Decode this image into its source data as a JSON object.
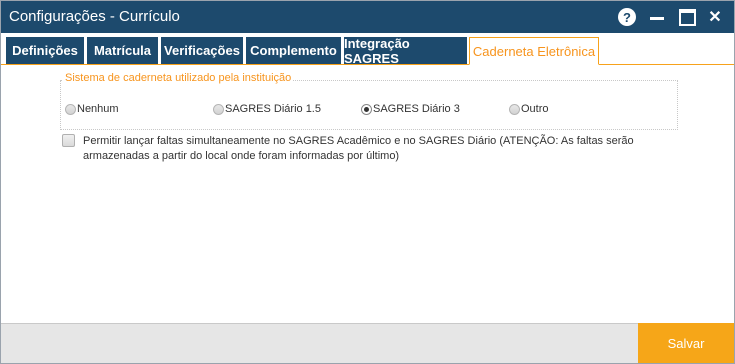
{
  "window": {
    "title": "Configurações - Currículo"
  },
  "titlebar": {
    "help_icon": "help-circle-icon",
    "help_glyph": "?",
    "close_glyph": "✕"
  },
  "tabs": [
    {
      "label": "Definições"
    },
    {
      "label": "Matrícula"
    },
    {
      "label": "Verificações"
    },
    {
      "label": "Complemento"
    },
    {
      "label": "Integração SAGRES"
    },
    {
      "label": "Caderneta Eletrônica",
      "active": true
    }
  ],
  "caderneta": {
    "group_label": "Sistema de caderneta utilizado pela instituição",
    "options": [
      {
        "label": "Nenhum",
        "checked": false
      },
      {
        "label": "SAGRES Diário 1.5",
        "checked": false
      },
      {
        "label": "SAGRES Diário 3",
        "checked": true
      },
      {
        "label": "Outro",
        "checked": false
      }
    ],
    "faltas_checkbox": {
      "checked": false,
      "label": "Permitir lançar faltas simultaneamente no SAGRES Acadêmico e no SAGRES Diário (ATENÇÃO: As faltas serão armazenadas a partir do local onde foram informadas por último)"
    }
  },
  "footer": {
    "save_label": "Salvar"
  },
  "colors": {
    "titlebar": "#1d4a6d",
    "accent": "#f7941d",
    "save_button": "#f6a618"
  }
}
